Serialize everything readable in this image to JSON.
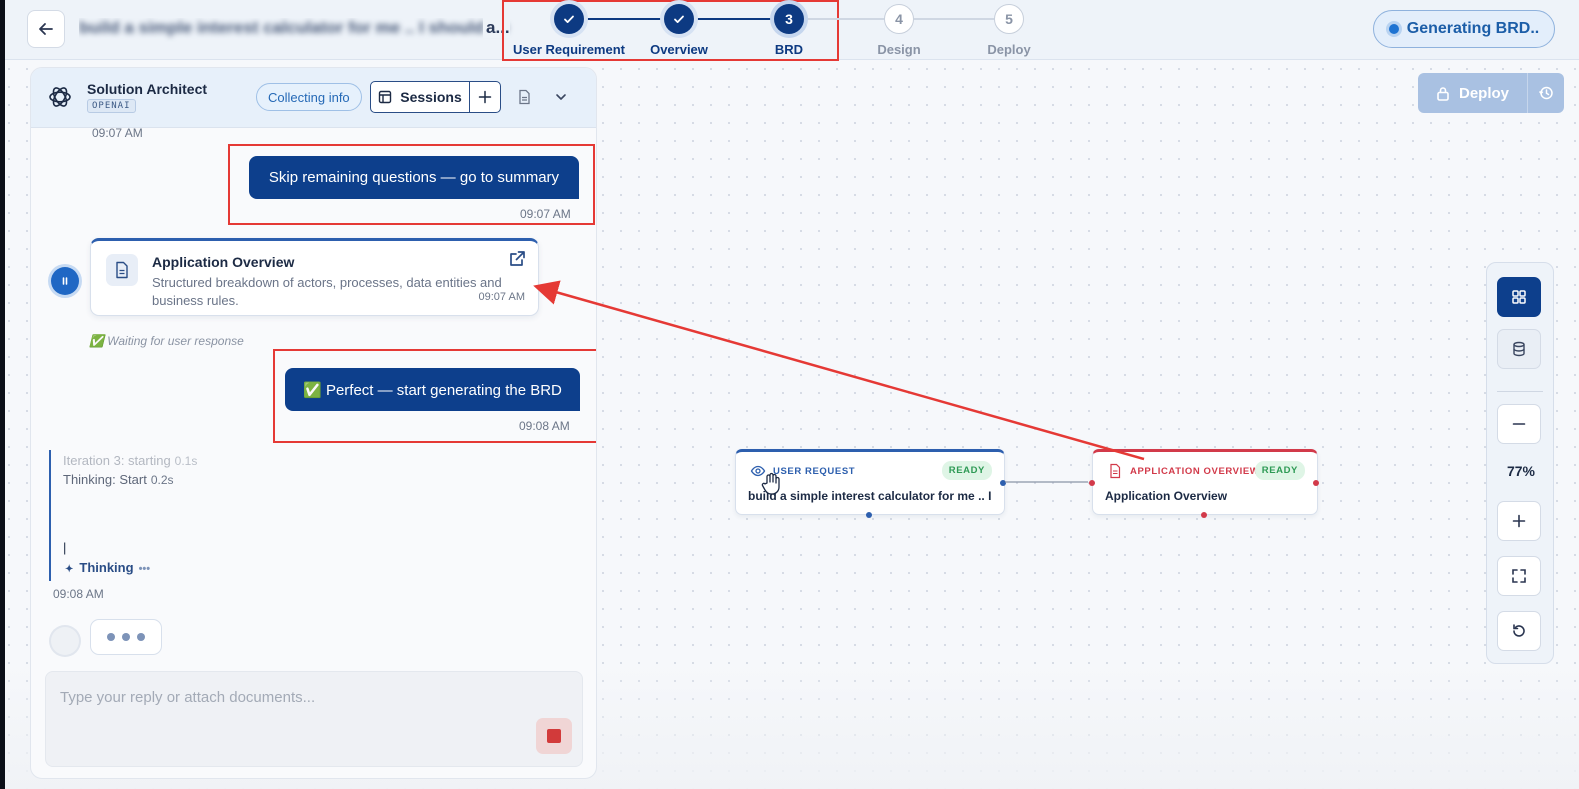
{
  "header": {
    "back_icon": "arrow-left-icon",
    "project_title_visible": "a...",
    "project_title_blurred": "build a simple interest calculator for me .. I should be",
    "steps": [
      {
        "num": "1",
        "label": "User Requirement",
        "state": "done"
      },
      {
        "num": "2",
        "label": "Overview",
        "state": "done"
      },
      {
        "num": "3",
        "label": "BRD",
        "state": "active"
      },
      {
        "num": "4",
        "label": "Design",
        "state": "todo"
      },
      {
        "num": "5",
        "label": "Deploy",
        "state": "todo"
      }
    ],
    "status_pill": "Generating BRD.."
  },
  "chat": {
    "agent_name": "Solution Architect",
    "agent_provider": "OPENAI",
    "status": "Collecting info",
    "sessions_label": "Sessions",
    "top_timestamp": "09:07 AM",
    "msg1": {
      "text": "Skip remaining questions — go to summary",
      "time": "09:07 AM"
    },
    "card": {
      "title": "Application Overview",
      "description": "Structured breakdown of actors, processes, data entities and business rules.",
      "time": "09:07 AM"
    },
    "waiting_text": "✅ Waiting for user response",
    "msg2": {
      "text": "✅ Perfect — start generating the BRD",
      "time": "09:08 AM"
    },
    "thinking": {
      "line1": "Iteration 3: starting",
      "line1_dur": "0.1s",
      "line2": "Thinking: Start",
      "line2_dur": "0.2s",
      "cursor": "|",
      "label": "Thinking",
      "time": "09:08 AM"
    },
    "input_placeholder": "Type your reply or attach documents..."
  },
  "canvas": {
    "deploy_label": "Deploy",
    "zoom_level": "77%",
    "nodes": [
      {
        "type": "USER REQUEST",
        "badge": "READY",
        "text": "build a simple interest calculator for me .. I ...",
        "color": "#2d5fae"
      },
      {
        "type": "APPLICATION OVERVIEW",
        "badge": "READY",
        "text": "Application Overview",
        "color": "#d23a4a"
      }
    ]
  },
  "colors": {
    "brand": "#0d3f8c",
    "annotation_red": "#e53935",
    "ready_green": "#2e9a55"
  }
}
